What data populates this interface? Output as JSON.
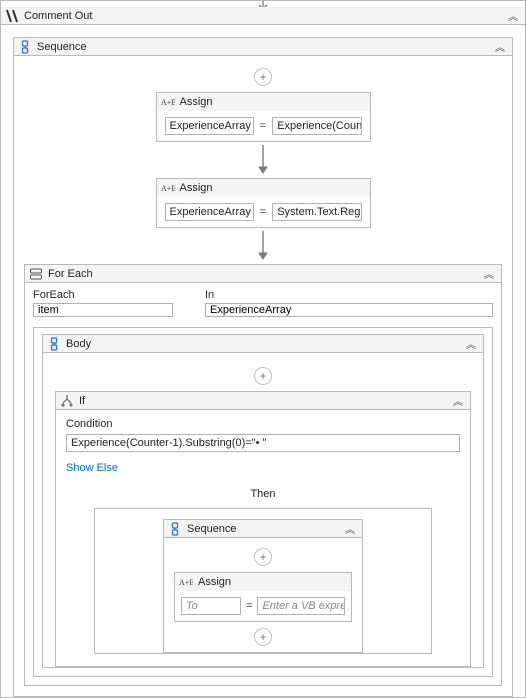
{
  "commentOut": {
    "title": "Comment Out"
  },
  "sequence1": {
    "title": "Sequence"
  },
  "assign1": {
    "title": "Assign",
    "left": "ExperienceArray",
    "right": "Experience(Counte"
  },
  "assign2": {
    "title": "Assign",
    "left": "ExperienceArray",
    "right": "System.Text.Regula"
  },
  "foreach": {
    "title": "For Each",
    "varLabel": "ForEach",
    "varValue": "item",
    "inLabel": "In",
    "inValue": "ExperienceArray"
  },
  "body": {
    "title": "Body"
  },
  "ifblock": {
    "title": "If",
    "conditionLabel": "Condition",
    "condition": "Experience(Counter-1).Substring(0)=\"• \"",
    "showElse": "Show Else",
    "thenLabel": "Then"
  },
  "sequence2": {
    "title": "Sequence"
  },
  "assign3": {
    "title": "Assign",
    "leftPlaceholder": "To",
    "rightPlaceholder": "Enter a VB expressi"
  },
  "glyphs": {
    "chev": "︽",
    "plus": "+",
    "eq": "="
  }
}
